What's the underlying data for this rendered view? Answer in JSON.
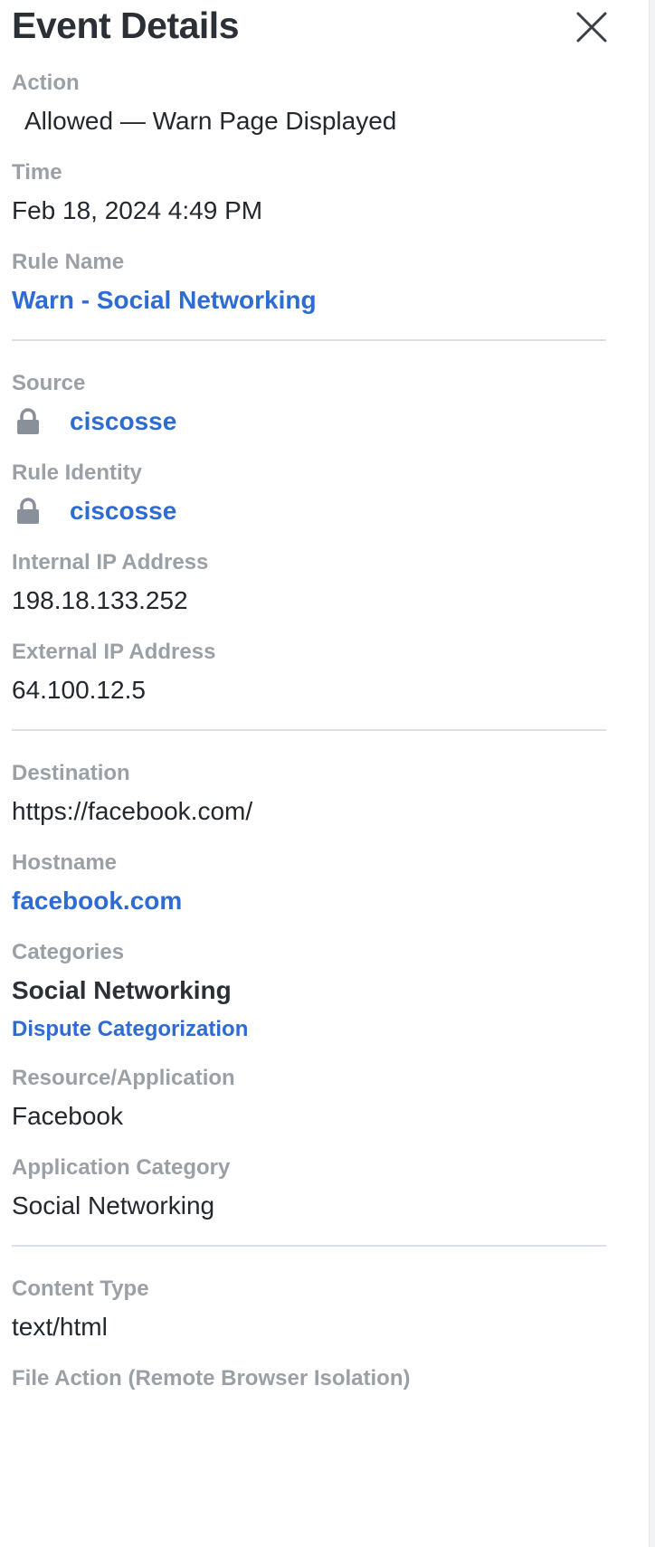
{
  "panel": {
    "title": "Event Details",
    "close_icon": "close-icon"
  },
  "action": {
    "label": "Action",
    "value": "Allowed — Warn Page Displayed"
  },
  "time": {
    "label": "Time",
    "value": "Feb 18, 2024 4:49 PM"
  },
  "rule_name": {
    "label": "Rule Name",
    "value": "Warn - Social Networking"
  },
  "source": {
    "label": "Source",
    "value": "ciscosse",
    "icon": "lock-icon"
  },
  "rule_identity": {
    "label": "Rule Identity",
    "value": "ciscosse",
    "icon": "lock-icon"
  },
  "internal_ip": {
    "label": "Internal IP Address",
    "value": "198.18.133.252"
  },
  "external_ip": {
    "label": "External IP Address",
    "value": "64.100.12.5"
  },
  "destination": {
    "label": "Destination",
    "value": "https://facebook.com/"
  },
  "hostname": {
    "label": "Hostname",
    "value": "facebook.com"
  },
  "categories": {
    "label": "Categories",
    "value": "Social Networking",
    "dispute_link": "Dispute Categorization"
  },
  "resource_application": {
    "label": "Resource/Application",
    "value": "Facebook"
  },
  "application_category": {
    "label": "Application Category",
    "value": "Social Networking"
  },
  "content_type": {
    "label": "Content Type",
    "value": "text/html"
  },
  "file_action": {
    "label": "File Action (Remote Browser Isolation)"
  },
  "colors": {
    "label": "#9aa0a6",
    "text": "#23282e",
    "link": "#2e6bd2",
    "divider": "#dcdfe3",
    "icon": "#8a9099"
  }
}
